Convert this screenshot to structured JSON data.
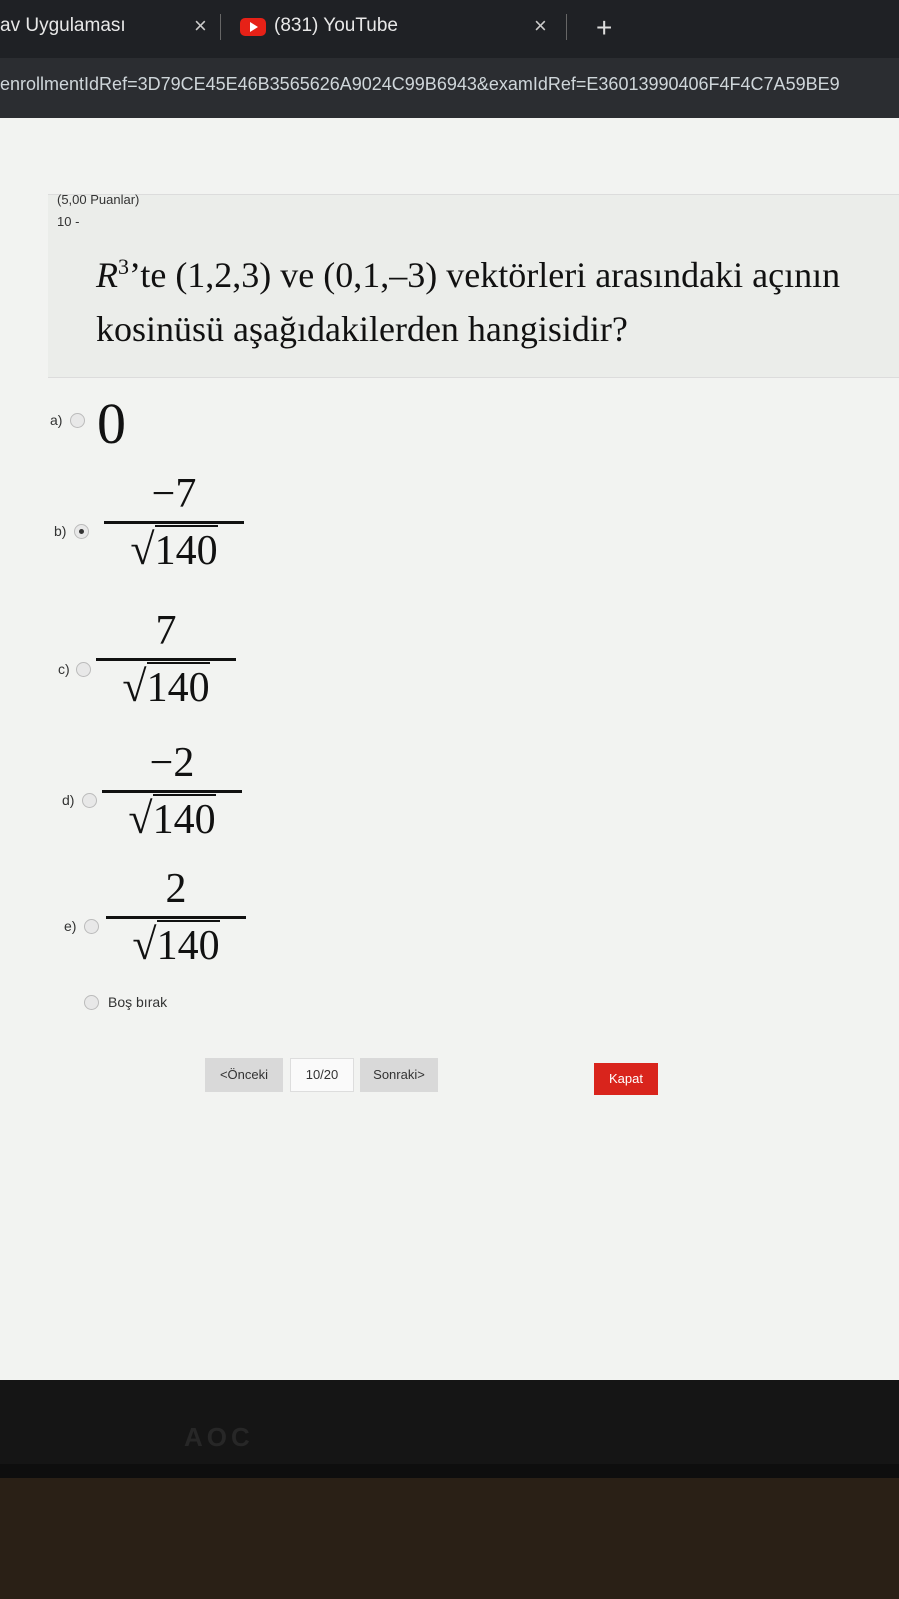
{
  "browser": {
    "tab1_title": "av Uygulaması",
    "tab2_title": "(831) YouTube",
    "close_glyph": "×",
    "new_tab_glyph": "+",
    "url": "enrollmentIdRef=3D79CE45E46B3565626A9024C99B6943&examIdRef=E36013990406F4F4C7A59BE9"
  },
  "question": {
    "points": "(5,00 Puanlar)",
    "number": "10 -",
    "text_prefix": "R",
    "text_sup": "3",
    "text_rest": "’te (1,2,3) ve (0,1,–3) vektörleri arasındaki açının kosinüsü aşağıdakilerden hangisidir?"
  },
  "options": [
    {
      "label": "a)",
      "value": "0",
      "selected": false
    },
    {
      "label": "b)",
      "numerator": "−7",
      "denominator": "140",
      "selected": true
    },
    {
      "label": "c)",
      "numerator": "7",
      "denominator": "140",
      "selected": false
    },
    {
      "label": "d)",
      "numerator": "−2",
      "denominator": "140",
      "selected": false
    },
    {
      "label": "e)",
      "numerator": "2",
      "denominator": "140",
      "selected": false
    }
  ],
  "skip_label": "Boş bırak",
  "navigation": {
    "prev_label": "<Önceki",
    "page_indicator": "10/20",
    "next_label": "Sonraki>",
    "close_label": "Kapat"
  },
  "monitor_logo": "AOC"
}
